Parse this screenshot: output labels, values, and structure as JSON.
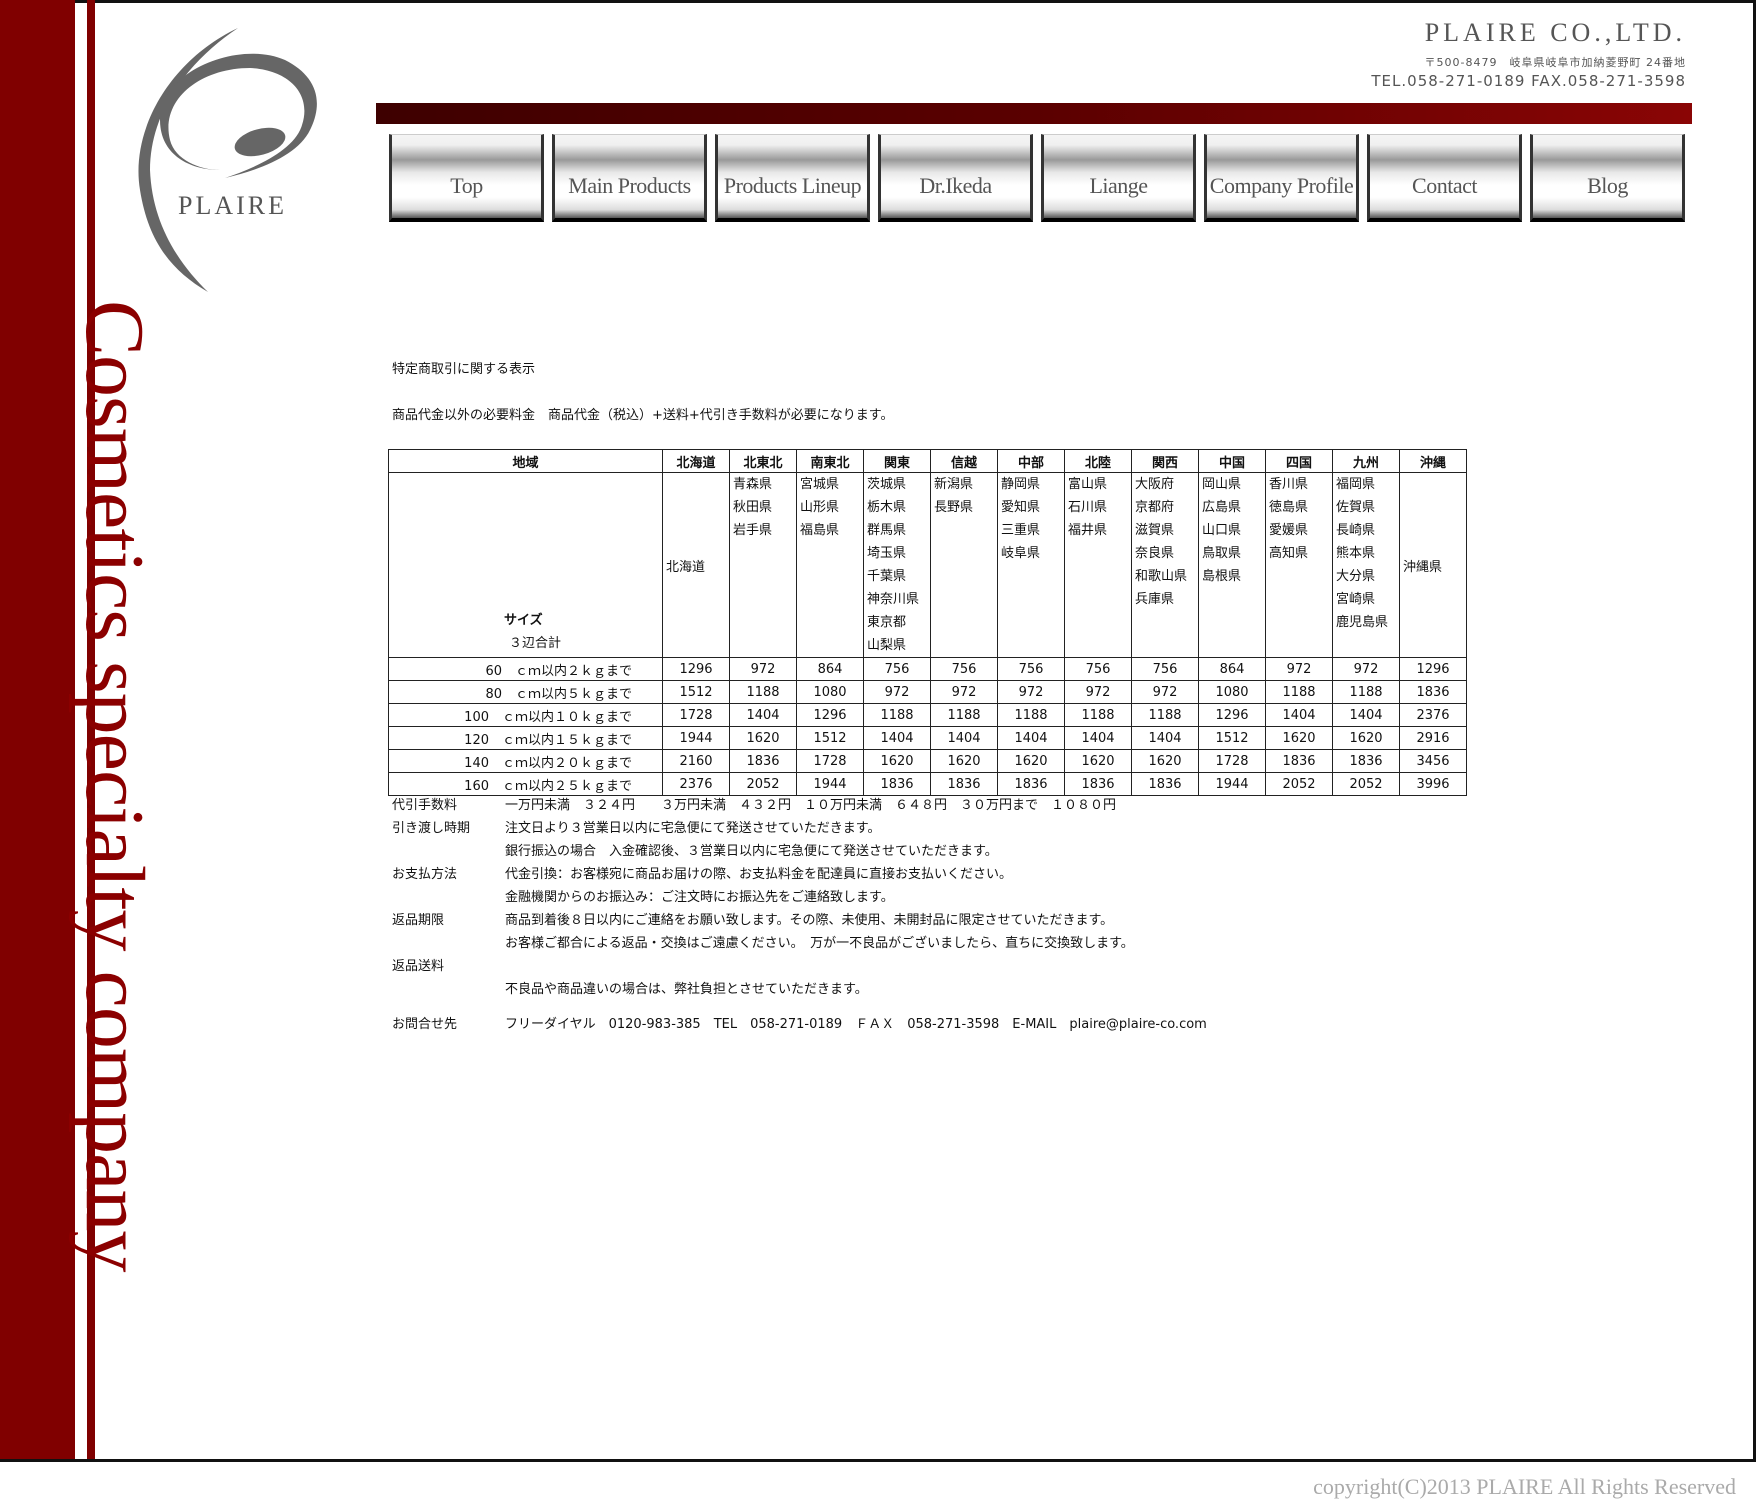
{
  "brand": {
    "logo_text": "PLAIRE",
    "tagline": "Cosmetics specialty company",
    "company_name": "PLAIRE CO.,LTD.",
    "address": "〒500-8479　岐阜県岐阜市加納菱野町 24番地",
    "tel_fax": "TEL.058-271-0189 FAX.058-271-3598",
    "colors": {
      "primary": "#800000",
      "nav_text": "#555555"
    }
  },
  "nav": [
    "Top",
    "Main Products",
    "Products Lineup",
    "Dr.Ikeda",
    "Liange",
    "Company Profile",
    "Contact",
    "Blog"
  ],
  "main": {
    "title": "特定商取引に関する表示",
    "fee_note": "商品代金以外の必要料金　商品代金（税込）+送料+代引き手数料が必要になります。"
  },
  "table": {
    "corner_label": "地域",
    "size_label": "サイズ",
    "size_sub": "３辺合計",
    "regions": [
      "北海道",
      "北東北",
      "南東北",
      "関東",
      "信越",
      "中部",
      "北陸",
      "関西",
      "中国",
      "四国",
      "九州",
      "沖縄"
    ],
    "prefectures": [
      [
        "北海道"
      ],
      [
        "青森県",
        "秋田県",
        "岩手県"
      ],
      [
        "宮城県",
        "山形県",
        "福島県"
      ],
      [
        "茨城県",
        "栃木県",
        "群馬県",
        "埼玉県",
        "千葉県",
        "神奈川県",
        "東京都",
        "山梨県"
      ],
      [
        "新潟県",
        "長野県"
      ],
      [
        "静岡県",
        "愛知県",
        "三重県",
        "岐阜県"
      ],
      [
        "富山県",
        "石川県",
        "福井県"
      ],
      [
        "大阪府",
        "京都府",
        "滋賀県",
        "奈良県",
        "和歌山県",
        "兵庫県"
      ],
      [
        "岡山県",
        "広島県",
        "山口県",
        "鳥取県",
        "島根県"
      ],
      [
        "香川県",
        "徳島県",
        "愛媛県",
        "高知県"
      ],
      [
        "福岡県",
        "佐賀県",
        "長崎県",
        "熊本県",
        "大分県",
        "宮崎県",
        "鹿児島県"
      ],
      [
        "沖縄県"
      ]
    ],
    "rows": [
      {
        "size": "60　ｃｍ以内２ｋｇまで",
        "prices": [
          "1296",
          "972",
          "864",
          "756",
          "756",
          "756",
          "756",
          "756",
          "864",
          "972",
          "972",
          "1296"
        ]
      },
      {
        "size": "80　ｃｍ以内５ｋｇまで",
        "prices": [
          "1512",
          "1188",
          "1080",
          "972",
          "972",
          "972",
          "972",
          "972",
          "1080",
          "1188",
          "1188",
          "1836"
        ]
      },
      {
        "size": "100　ｃｍ以内１０ｋｇまで",
        "prices": [
          "1728",
          "1404",
          "1296",
          "1188",
          "1188",
          "1188",
          "1188",
          "1188",
          "1296",
          "1404",
          "1404",
          "2376"
        ]
      },
      {
        "size": "120　ｃｍ以内１５ｋｇまで",
        "prices": [
          "1944",
          "1620",
          "1512",
          "1404",
          "1404",
          "1404",
          "1404",
          "1404",
          "1512",
          "1620",
          "1620",
          "2916"
        ]
      },
      {
        "size": "140　ｃｍ以内２０ｋｇまで",
        "prices": [
          "2160",
          "1836",
          "1728",
          "1620",
          "1620",
          "1620",
          "1620",
          "1620",
          "1728",
          "1836",
          "1836",
          "3456"
        ]
      },
      {
        "size": "160　ｃｍ以内２５ｋｇまで",
        "prices": [
          "2376",
          "2052",
          "1944",
          "1836",
          "1836",
          "1836",
          "1836",
          "1836",
          "1944",
          "2052",
          "2052",
          "3996"
        ]
      }
    ]
  },
  "footer_info": [
    {
      "label": "代引手数料",
      "lines": [
        "一万円未満　３２４円　　３万円未満　４３２円　１０万円未満　６４８円　３０万円まで　１０８０円"
      ]
    },
    {
      "label": "引き渡し時期",
      "lines": [
        "注文日より３営業日以内に宅急便にて発送させていただきます。",
        "銀行振込の場合　入金確認後、３営業日以内に宅急便にて発送させていただきます。"
      ]
    },
    {
      "label": "お支払方法",
      "lines": [
        "代金引換：お客様宛に商品お届けの際、お支払料金を配達員に直接お支払いください。",
        "金融機関からのお振込み：ご注文時にお振込先をご連絡致します。"
      ]
    },
    {
      "label": "返品期限",
      "lines": [
        "商品到着後８日以内にご連絡をお願い致します。その際、未使用、未開封品に限定させていただきます。",
        "お客様ご都合による返品・交換はご遠慮ください。　万が一不良品がございましたら、直ちに交換致します。"
      ]
    },
    {
      "label": "返品送料",
      "lines": [
        "",
        "不良品や商品違いの場合は、弊社負担とさせていただきます。",
        ""
      ]
    },
    {
      "label": "お問合せ先",
      "lines": [
        "フリーダイヤル　0120-983-385　TEL　058-271-0189　ＦＡＸ　058-271-3598　E-MAIL　plaire@plaire-co.com"
      ]
    }
  ],
  "copyright": "copyright(C)2013 PLAIRE All Rights  Reserved"
}
